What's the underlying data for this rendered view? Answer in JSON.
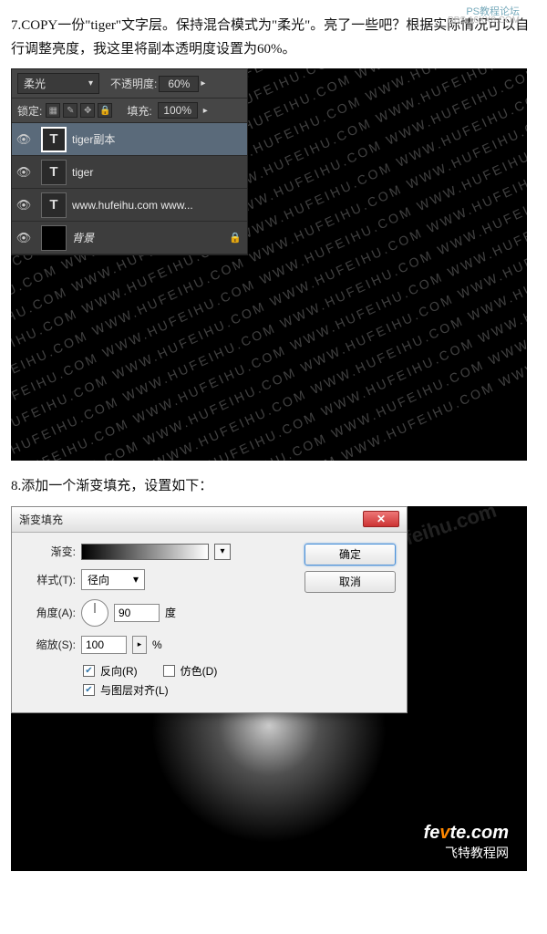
{
  "forum_tag": "PS教程论坛",
  "forum_sub": "BBS.16XX8.COM",
  "instructions": {
    "step7": "7.COPY一份\"tiger\"文字层。保持混合模式为\"柔光\"。亮了一些吧？根据实际情况可以自行调整亮度，我这里将副本透明度设置为60%。",
    "step8": "8.添加一个渐变填充，设置如下："
  },
  "layers_panel": {
    "blend_mode": "柔光",
    "opacity_label": "不透明度:",
    "opacity_value": "60%",
    "lock_label": "锁定:",
    "fill_label": "填充:",
    "fill_value": "100%",
    "layers": [
      {
        "type": "T",
        "name": "tiger副本",
        "visible": true,
        "selected": true
      },
      {
        "type": "T",
        "name": "tiger",
        "visible": true,
        "selected": false
      },
      {
        "type": "T",
        "name": "www.hufeihu.com  www...",
        "visible": true,
        "selected": false
      },
      {
        "type": "bg",
        "name": "背景",
        "visible": true,
        "selected": false,
        "locked": true
      }
    ]
  },
  "bg_repeat_text": "WWW.HUFEIHU.COM",
  "watermark2": "www.hufeihu.com",
  "dialog": {
    "title": "渐变填充",
    "ok": "确定",
    "cancel": "取消",
    "gradient_label": "渐变:",
    "style_label": "样式(T):",
    "style_value": "径向",
    "angle_label": "角度(A):",
    "angle_value": "90",
    "angle_unit": "度",
    "scale_label": "缩放(S):",
    "scale_value": "100",
    "scale_unit": "%",
    "reverse": "反向(R)",
    "dither": "仿色(D)",
    "align": "与图层对齐(L)"
  },
  "footer": {
    "main_a": "fe",
    "main_b": "v",
    "main_c": "te",
    "main_d": ".com",
    "sub": "飞特教程网"
  }
}
